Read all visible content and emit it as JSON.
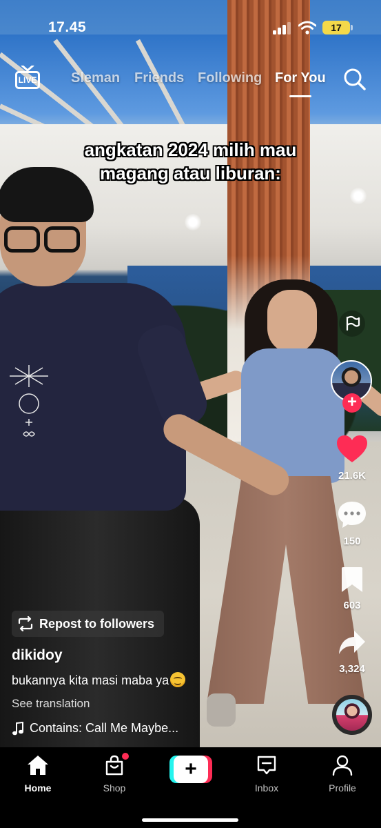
{
  "status_bar": {
    "time": "17.45",
    "battery": "17",
    "icons": [
      "signal-icon",
      "wifi-icon",
      "battery-icon"
    ]
  },
  "top_nav": {
    "live_label": "LIVE",
    "tabs": [
      {
        "label": "Sleman",
        "active": false
      },
      {
        "label": "Friends",
        "active": false
      },
      {
        "label": "Following",
        "active": false
      },
      {
        "label": "For You",
        "active": true
      }
    ],
    "search_icon": "search-icon"
  },
  "video": {
    "caption_line1": "angkatan 2024 milih mau",
    "caption_line2": "magang atau liburan:"
  },
  "actions": {
    "likes": "21.6K",
    "comments": "150",
    "bookmarks": "603",
    "shares": "3,324",
    "accent_color": "#fe2c55"
  },
  "post": {
    "repost_label": "Repost to followers",
    "username": "dikidoy",
    "description": "bukannya kita masi maba ya",
    "see_translation": "See translation",
    "music": "Contains: Call Me Maybe..."
  },
  "tab_bar": {
    "home": "Home",
    "shop": "Shop",
    "inbox": "Inbox",
    "profile": "Profile"
  }
}
